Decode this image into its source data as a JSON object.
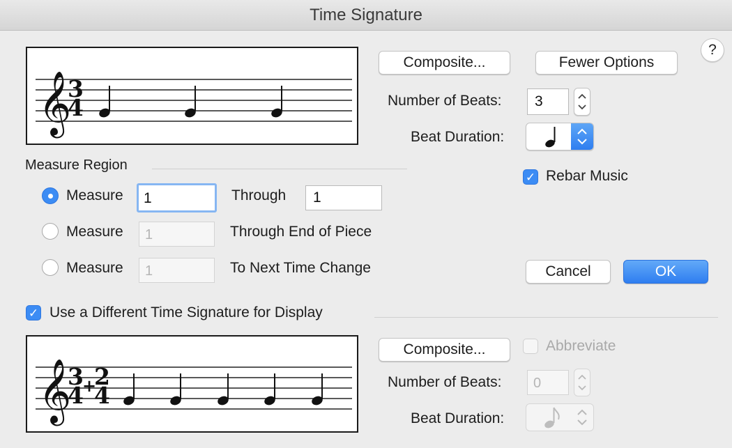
{
  "window": {
    "title": "Time Signature"
  },
  "help": {
    "label": "?"
  },
  "main": {
    "composite_label": "Composite...",
    "fewer_options_label": "Fewer Options",
    "beats_label": "Number of Beats:",
    "beats_value": "3",
    "duration_label": "Beat Duration:",
    "duration_icon": "quarter-note-icon",
    "rebar_label": "Rebar Music",
    "rebar_checked": true,
    "preview": {
      "numerator": "3",
      "denominator": "4"
    }
  },
  "region": {
    "heading": "Measure Region",
    "rows": [
      {
        "radio_label": "Measure",
        "from": "1",
        "middle_label": "Through",
        "to": "1",
        "selected": true
      },
      {
        "radio_label": "Measure",
        "from": "1",
        "middle_label": "Through End of Piece",
        "selected": false
      },
      {
        "radio_label": "Measure",
        "from": "1",
        "middle_label": "To Next Time Change",
        "selected": false
      }
    ]
  },
  "actions": {
    "cancel_label": "Cancel",
    "ok_label": "OK"
  },
  "display": {
    "checkbox_label": "Use a Different Time Signature for Display",
    "checked": true,
    "composite_label": "Composite...",
    "abbreviate_label": "Abbreviate",
    "beats_label": "Number of Beats:",
    "beats_value": "0",
    "duration_label": "Beat Duration:",
    "duration_icon": "eighth-note-icon",
    "preview": {
      "num1": "3",
      "den1": "4",
      "plus": "+",
      "num2": "2",
      "den2": "4"
    }
  },
  "colors": {
    "accent": "#3c8cf4",
    "background": "#ececec"
  }
}
